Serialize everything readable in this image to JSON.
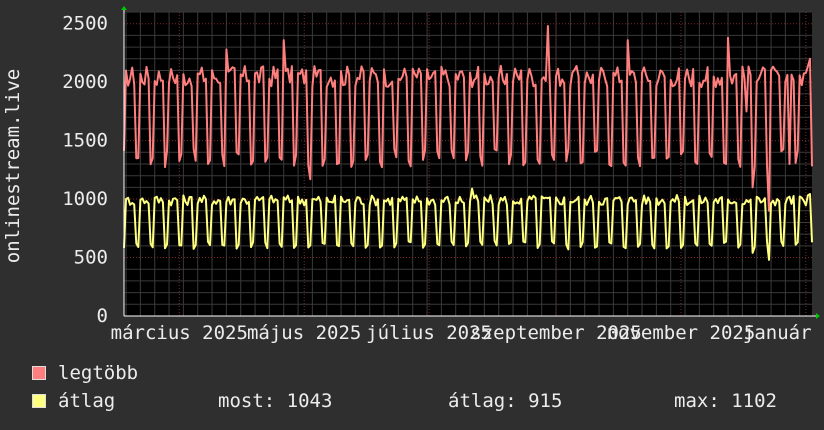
{
  "chart_data": {
    "type": "line",
    "title": "",
    "xlabel": "",
    "ylabel": "onlinestream.live",
    "ylim": [
      0,
      2600
    ],
    "xlim": [
      "2025-02-02",
      "2026-01-04"
    ],
    "yticks": [
      0,
      500,
      1000,
      1500,
      2000,
      2500
    ],
    "xtick_labels": [
      {
        "date": "2025-03-01",
        "label": "március 2025"
      },
      {
        "date": "2025-05-01",
        "label": "május 2025"
      },
      {
        "date": "2025-07-01",
        "label": "július 2025"
      },
      {
        "date": "2025-09-01",
        "label": "szeptember 2025"
      },
      {
        "date": "2025-11-01",
        "label": "november 2025"
      },
      {
        "date": "2026-01-01",
        "label": "január 2026"
      }
    ],
    "grid": true,
    "legend_position": "bottom",
    "weekly_pattern": "weekday values high, weekend dips (Sat/Sun)",
    "series": [
      {
        "name": "legtöbb",
        "color": "#ff7f7f",
        "weekday_level": 2050,
        "weekend_dip": 1350,
        "samples": [
          {
            "x": "2025-02-03",
            "y": 2100
          },
          {
            "x": "2025-02-08",
            "y": 1350
          },
          {
            "x": "2025-03-15",
            "y": 1300
          },
          {
            "x": "2025-03-24",
            "y": 2280
          },
          {
            "x": "2025-04-21",
            "y": 2360
          },
          {
            "x": "2025-05-04",
            "y": 1170
          },
          {
            "x": "2025-08-28",
            "y": 2480
          },
          {
            "x": "2025-10-06",
            "y": 2360
          },
          {
            "x": "2025-11-24",
            "y": 2380
          },
          {
            "x": "2025-12-03",
            "y": 1750
          },
          {
            "x": "2025-12-06",
            "y": 1100
          },
          {
            "x": "2025-12-14",
            "y": 900
          },
          {
            "x": "2025-12-24",
            "y": 1300
          },
          {
            "x": "2026-01-03",
            "y": 2200
          }
        ]
      },
      {
        "name": "átlag",
        "color": "#ffff80",
        "weekday_level": 990,
        "weekend_dip": 610,
        "samples": [
          {
            "x": "2025-02-03",
            "y": 1000
          },
          {
            "x": "2025-02-08",
            "y": 620
          },
          {
            "x": "2025-07-22",
            "y": 1090
          },
          {
            "x": "2025-09-07",
            "y": 570
          },
          {
            "x": "2025-12-06",
            "y": 540
          },
          {
            "x": "2025-12-14",
            "y": 480
          },
          {
            "x": "2026-01-03",
            "y": 1043
          }
        ]
      }
    ]
  },
  "legend": [
    {
      "name": "legtöbb",
      "color": "#ff7f7f"
    },
    {
      "name": "átlag",
      "color": "#ffff80",
      "now_label": "most:",
      "now_value": "1043",
      "avg_label": "átlag:",
      "avg_value": "915",
      "max_label": "max:",
      "max_value": "1102"
    }
  ]
}
